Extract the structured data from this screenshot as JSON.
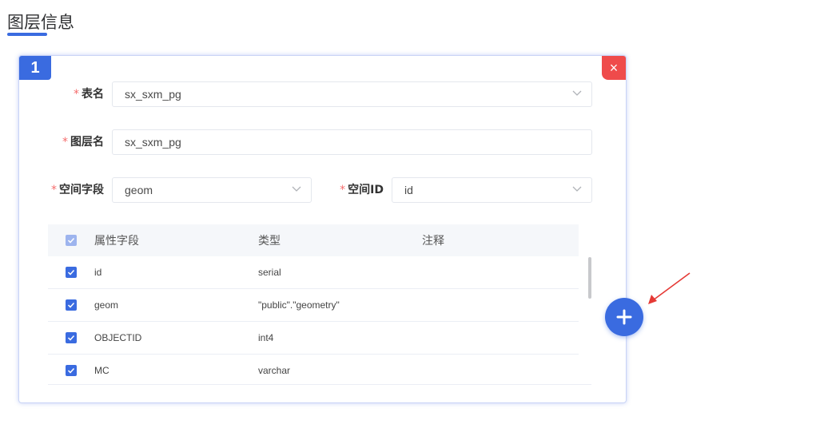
{
  "page": {
    "title": "图层信息"
  },
  "card": {
    "index": "1",
    "close_glyph": "×",
    "table_name": {
      "required_mark": "*",
      "label": "表名",
      "value": "sx_sxm_pg"
    },
    "layer_name": {
      "required_mark": "*",
      "label": "图层名",
      "value": "sx_sxm_pg"
    },
    "spatial_field": {
      "required_mark": "*",
      "label": "空间字段",
      "value": "geom"
    },
    "spatial_id": {
      "required_mark": "*",
      "label": "空间ID",
      "value": "id"
    },
    "table": {
      "headers": {
        "name": "属性字段",
        "type": "类型",
        "note": "注释"
      },
      "rows": [
        {
          "name": "id",
          "type": "serial",
          "note": "",
          "checked": true
        },
        {
          "name": "geom",
          "type": "\"public\".\"geometry\"",
          "note": "",
          "checked": true
        },
        {
          "name": "OBJECTID",
          "type": "int4",
          "note": "",
          "checked": true
        },
        {
          "name": "MC",
          "type": "varchar",
          "note": "",
          "checked": true
        }
      ]
    }
  },
  "colors": {
    "primary": "#3a6be0",
    "danger": "#ef4b4b",
    "annotation_arrow": "#e53935"
  },
  "icons": {
    "close": "close-icon",
    "add": "plus-icon",
    "dropdown": "chevron-down-icon",
    "check": "check-icon"
  }
}
